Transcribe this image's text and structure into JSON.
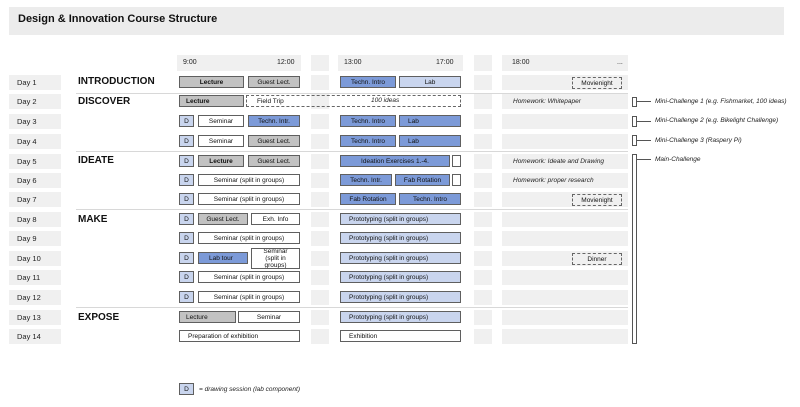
{
  "title": "Design & Innovation Course Structure",
  "times": {
    "t1": "9:00",
    "t2": "12:00",
    "t3": "13:00",
    "t4": "17:00",
    "t5": "18:00",
    "t6": "..."
  },
  "days": [
    "Day 1",
    "Day 2",
    "Day 3",
    "Day 4",
    "Day 5",
    "Day 6",
    "Day 7",
    "Day 8",
    "Day 9",
    "Day 10",
    "Day 11",
    "Day 12",
    "Day 13",
    "Day 14"
  ],
  "phases": {
    "p1": "INTRODUCTION",
    "p2": "DISCOVER",
    "p3": "IDEATE",
    "p4": "MAKE",
    "p5": "EXPOSE"
  },
  "sessions": {
    "lecture": "Lecture",
    "guest_lect": "Guest Lect.",
    "techn_intro": "Techn. Intro",
    "techn_intr": "Techn. Intr.",
    "lab": "Lab",
    "movienight": "Movienight",
    "field_trip": "Field Trip",
    "ideas_100": "100 ideas",
    "whitepaper": "Homework: Whitepaper",
    "d": "D",
    "seminar": "Seminar",
    "seminar_groups": "Seminar (split in groups)",
    "seminar_groups_wrapped": "Seminar (split in groups)",
    "ideation": "Ideation Exercises 1.-4.",
    "hw_ideate": "Homework: Ideate and Drawing",
    "fab_rotation": "Fab Rotation",
    "hw_research": "Homework: proper research",
    "exh_info": "Exh. Info",
    "prototyping": "Prototyping (split in groups)",
    "lab_tour": "Lab tour",
    "dinner": "Dinner",
    "prep_exhibition": "Preparation of exhibition",
    "exhibition": "Exhibition"
  },
  "challenges": {
    "c1": "Mini-Challenge 1 (e.g. Fishmarket, 100 ideas)",
    "c2": "Mini-Challenge 2 (e.g. Bikelight Challenge)",
    "c3": "Mini-Challenge 3 (Raspery Pi)",
    "c4": "Main-Challenge"
  },
  "legend": {
    "d": "D",
    "text": "= drawing session (lab component)"
  },
  "colors": {
    "dark_blue": "#7c9ad8",
    "light_blue": "#c9d5ee",
    "gray": "#c2c2c2",
    "row_bg": "#f0f0f0"
  }
}
